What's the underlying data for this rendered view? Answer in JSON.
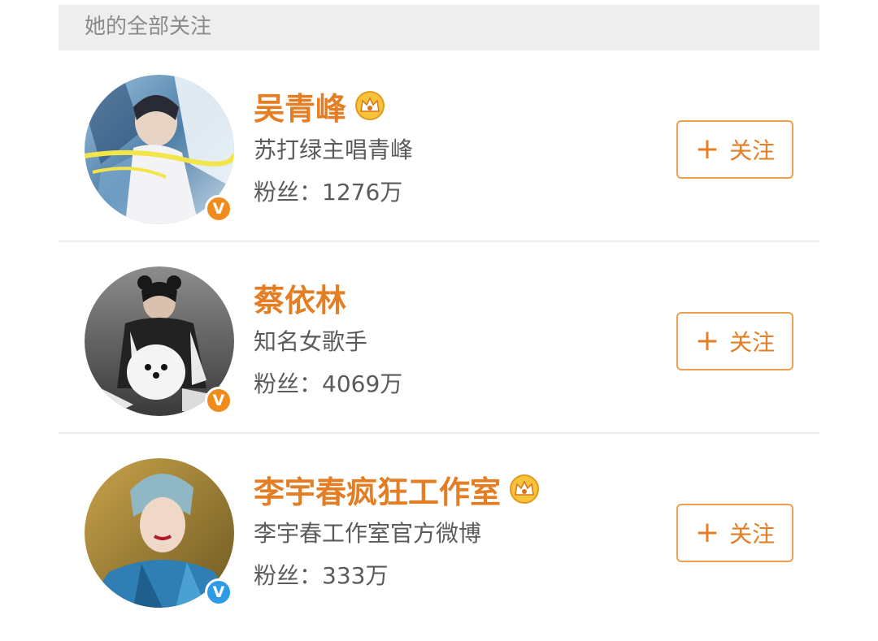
{
  "header": {
    "title": "她的全部关注"
  },
  "users": [
    {
      "name": "吴青峰",
      "description": "苏打绿主唱青峰",
      "fans_label": "粉丝：",
      "fans_count": "1276万",
      "follow_label": "关注",
      "follow_plus": "+",
      "verified_badge_color": "#f08c1c",
      "verified_badge_text": "V",
      "has_crown": true,
      "crown_icon": "vip-crown-icon"
    },
    {
      "name": "蔡依林",
      "description": "知名女歌手",
      "fans_label": "粉丝：",
      "fans_count": "4069万",
      "follow_label": "关注",
      "follow_plus": "+",
      "verified_badge_color": "#f08c1c",
      "verified_badge_text": "V",
      "has_crown": false
    },
    {
      "name": "李宇春疯狂工作室",
      "description": "李宇春工作室官方微博",
      "fans_label": "粉丝：",
      "fans_count": "333万",
      "follow_label": "关注",
      "follow_plus": "+",
      "verified_badge_color": "#2d9be6",
      "verified_badge_text": "V",
      "has_crown": true,
      "crown_icon": "vip-crown-icon"
    }
  ],
  "colors": {
    "accent": "#e47e25",
    "button_border": "#eba14d",
    "header_bg": "#eeeeef",
    "text_secondary": "#5b5b5b"
  }
}
